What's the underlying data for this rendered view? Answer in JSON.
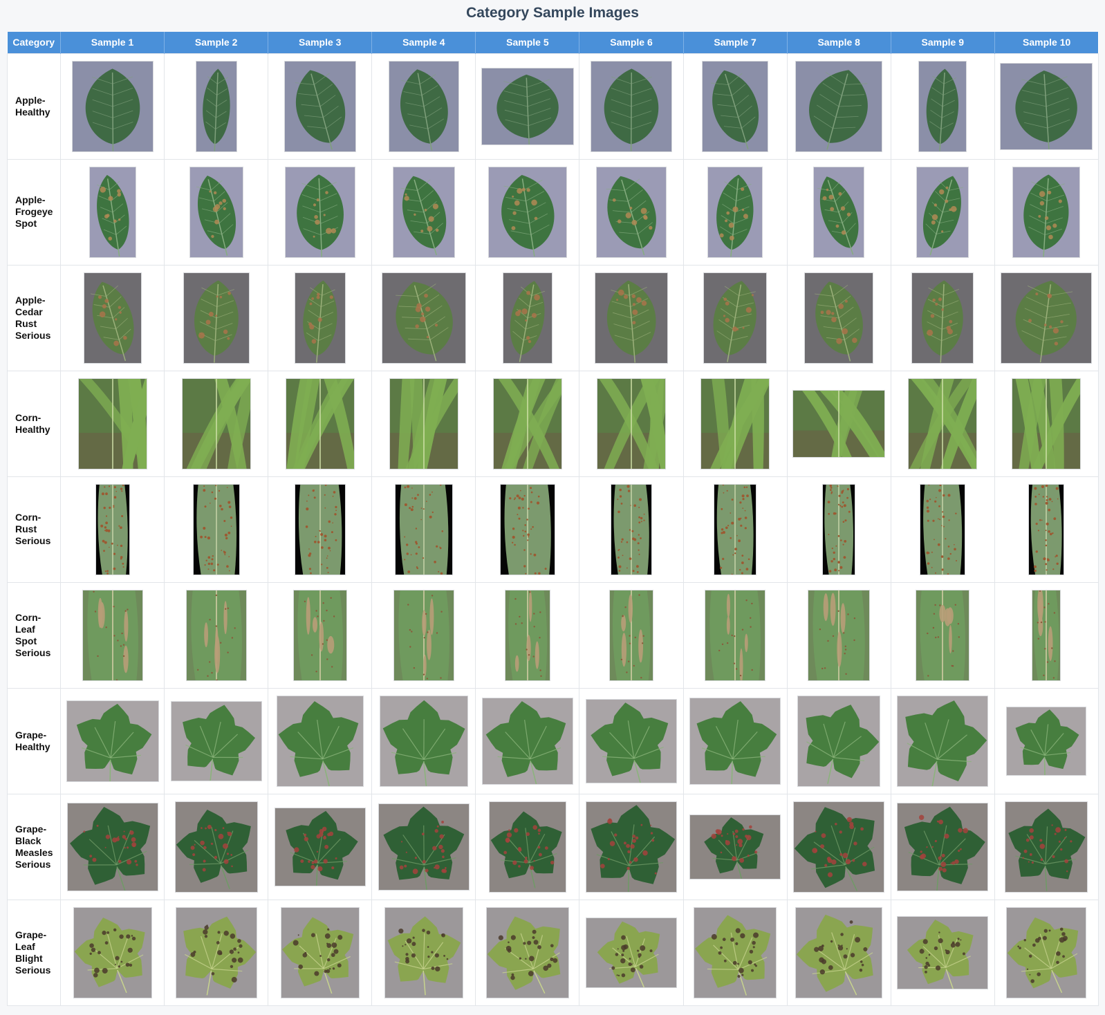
{
  "title": "Category Sample Images",
  "table": {
    "header": [
      "Category",
      "Sample 1",
      "Sample 2",
      "Sample 3",
      "Sample 4",
      "Sample 5",
      "Sample 6",
      "Sample 7",
      "Sample 8",
      "Sample 9",
      "Sample 10"
    ],
    "rows": [
      {
        "category": [
          "Apple-",
          "Healthy"
        ],
        "kind": "apple",
        "bg": "#8b8fa8",
        "leaf": "#3f6a44",
        "vein": "#7fa07c",
        "spot": null,
        "thumb_icon": "apple-leaf-icon"
      },
      {
        "category": [
          "Apple-",
          "Frogeye",
          "Spot"
        ],
        "kind": "apple",
        "bg": "#9b9bb5",
        "leaf": "#3e7440",
        "vein": "#86ad80",
        "spot": "#b08a55",
        "thumb_icon": "apple-leaf-icon"
      },
      {
        "category": [
          "Apple-",
          "Cedar",
          "Rust",
          "Serious"
        ],
        "kind": "apple",
        "bg": "#6e6c70",
        "leaf": "#5b7d45",
        "vein": "#9bb07a",
        "spot": "#a9734a",
        "thumb_icon": "apple-leaf-icon"
      },
      {
        "category": [
          "Corn-",
          "Healthy"
        ],
        "kind": "corn",
        "bg": "#5c7a45",
        "leaf": "#7fae52",
        "vein": "#cfe0a8",
        "spot": null,
        "thumb_icon": "corn-leaf-icon"
      },
      {
        "category": [
          "Corn-",
          "Rust",
          "Serious"
        ],
        "kind": "cornrust",
        "bg": "#050505",
        "leaf": "#7c9a6e",
        "vein": "#c6d3a8",
        "spot": "#9c5a32",
        "thumb_icon": "corn-leaf-icon"
      },
      {
        "category": [
          "Corn-",
          "Leaf",
          "Spot",
          "Serious"
        ],
        "kind": "cornspot",
        "bg": "#6e8a5a",
        "leaf": "#6f9a5e",
        "vein": "#d8d0a8",
        "spot": "#b89d78",
        "thumb_icon": "corn-leaf-icon"
      },
      {
        "category": [
          "Grape-",
          "Healthy"
        ],
        "kind": "grape",
        "bg": "#a9a4a6",
        "leaf": "#477e3f",
        "vein": "#8ab47a",
        "spot": null,
        "thumb_icon": "grape-leaf-icon"
      },
      {
        "category": [
          "Grape-",
          "Black",
          "Measles",
          "Serious"
        ],
        "kind": "grape",
        "bg": "#8c8683",
        "leaf": "#2f6035",
        "vein": "#6f9a66",
        "spot": "#a3423c",
        "thumb_icon": "grape-leaf-icon"
      },
      {
        "category": [
          "Grape-",
          "Leaf",
          "Blight",
          "Serious"
        ],
        "kind": "grape",
        "bg": "#9c989a",
        "leaf": "#8aa550",
        "vein": "#c7d38e",
        "spot": "#4a3a2a",
        "thumb_icon": "grape-leaf-icon"
      }
    ]
  }
}
